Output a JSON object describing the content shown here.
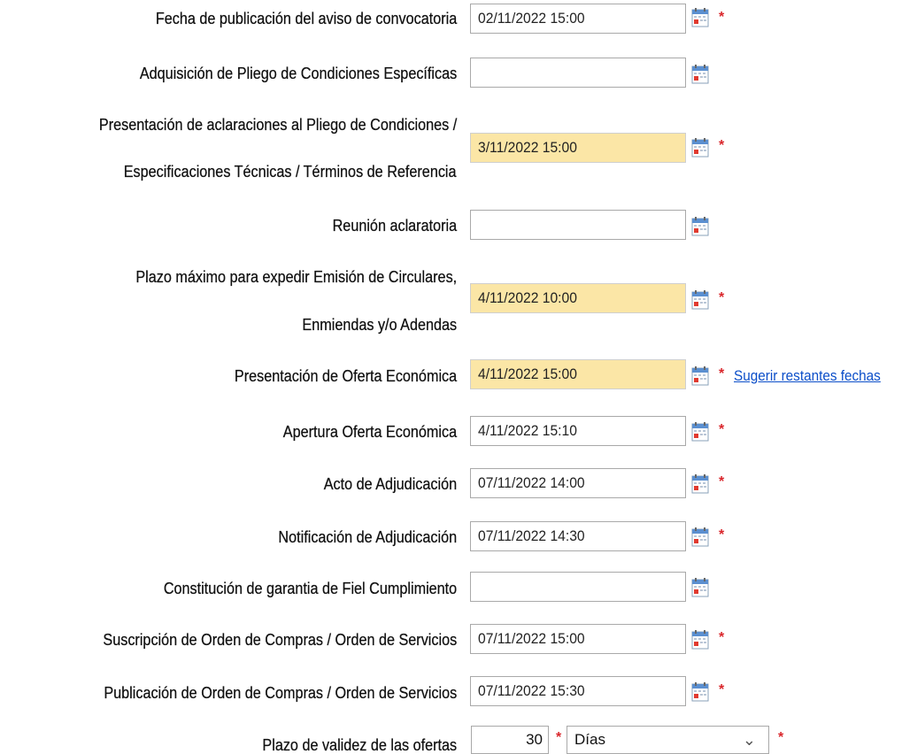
{
  "rows": [
    {
      "label": "Fecha de publicación del aviso de convocatoria",
      "value": "02/11/2022 15:00",
      "highlighted": false,
      "required": true
    },
    {
      "label": "Adquisición de Pliego de Condiciones Específicas",
      "value": "",
      "highlighted": false,
      "required": false
    },
    {
      "label_line1": "Presentación de aclaraciones al Pliego de Condiciones /",
      "label_line2": "Especificaciones Técnicas / Términos de Referencia",
      "value": "3/11/2022 15:00",
      "highlighted": true,
      "required": true
    },
    {
      "label": "Reunión aclaratoria",
      "value": "",
      "highlighted": false,
      "required": false
    },
    {
      "label_line1": "Plazo máximo para expedir Emisión de Circulares,",
      "label_line2": "Enmiendas y/o Adendas",
      "value": "4/11/2022 10:00",
      "highlighted": true,
      "required": true
    },
    {
      "label": "Presentación de Oferta Económica",
      "value": "4/11/2022 15:00",
      "highlighted": true,
      "required": true
    },
    {
      "label": "Apertura Oferta Económica",
      "value": "4/11/2022 15:10",
      "highlighted": false,
      "required": true
    },
    {
      "label": "Acto de Adjudicación",
      "value": "07/11/2022 14:00",
      "highlighted": false,
      "required": true
    },
    {
      "label": "Notificación de Adjudicación",
      "value": "07/11/2022 14:30",
      "highlighted": false,
      "required": true
    },
    {
      "label": "Constitución de garantia de Fiel Cumplimiento",
      "value": "",
      "highlighted": false,
      "required": false
    },
    {
      "label": "Suscripción de Orden de Compras / Orden de Servicios",
      "value": "07/11/2022 15:00",
      "highlighted": false,
      "required": true
    },
    {
      "label": "Publicación de Orden de Compras / Orden de Servicios",
      "value": "07/11/2022 15:30",
      "highlighted": false,
      "required": true
    }
  ],
  "suggest_link": "Sugerir restantes fechas",
  "validity": {
    "label": "Plazo de validez de las ofertas",
    "number": "30",
    "unit_selected": "Días"
  },
  "required_mark": "*",
  "icons": {
    "calendar": "calendar-icon",
    "chevron": "chevron-down-icon"
  },
  "colors": {
    "highlight": "#fbe6a6",
    "required": "#d9262b",
    "link": "#0b4ec9"
  }
}
